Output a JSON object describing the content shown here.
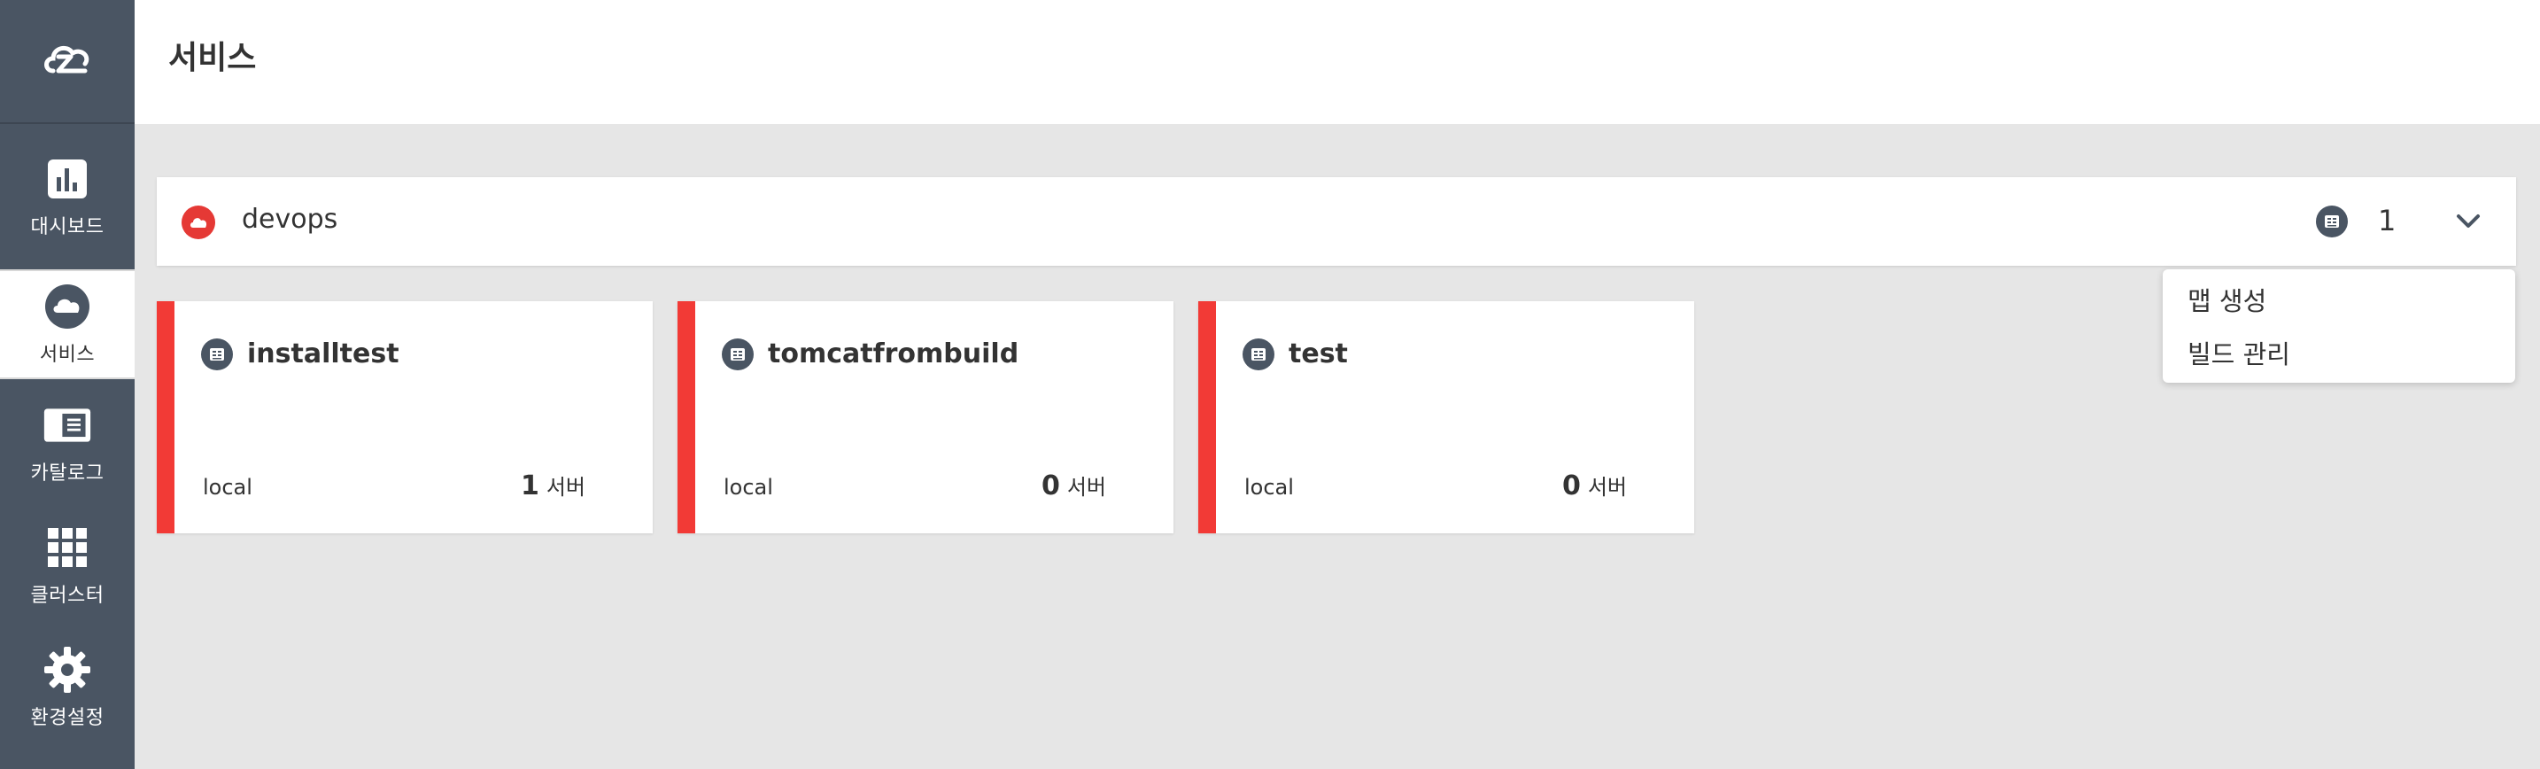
{
  "header": {
    "title": "서비스"
  },
  "sidebar": {
    "items": [
      {
        "label": "대시보드",
        "icon": "bar-chart-icon"
      },
      {
        "label": "서비스",
        "icon": "cloud-icon"
      },
      {
        "label": "카탈로그",
        "icon": "catalog-icon"
      },
      {
        "label": "클러스터",
        "icon": "grid-icon"
      },
      {
        "label": "환경설정",
        "icon": "gear-icon"
      }
    ],
    "active_item": "서비스"
  },
  "service": {
    "name": "devops",
    "count": "1"
  },
  "dropdown": {
    "items": [
      "맵 생성",
      "빌드 관리"
    ]
  },
  "cards": [
    {
      "title": "installtest",
      "env": "local",
      "servers": "1",
      "servers_label": "서버"
    },
    {
      "title": "tomcatfrombuild",
      "env": "local",
      "servers": "0",
      "servers_label": "서버"
    },
    {
      "title": "test",
      "env": "local",
      "servers": "0",
      "servers_label": "서버"
    }
  ],
  "colors": {
    "sidebar_bg": "#4a5563",
    "accent_red": "#f23a36",
    "background": "#e6e6e6"
  }
}
